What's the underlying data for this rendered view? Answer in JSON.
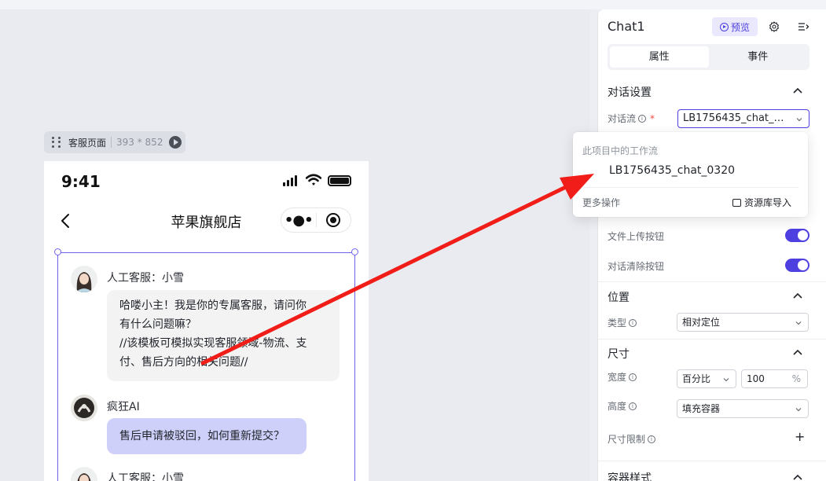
{
  "canvas": {
    "page_tag": {
      "name": "客服页面",
      "dims": "393 * 852"
    },
    "phone": {
      "time": "9:41",
      "nav_title": "苹果旗舰店",
      "capsule_dots": "•●•",
      "messages": [
        {
          "sender": "人工客服：小雪",
          "lines": [
            "哈喽小主！我是你的专属客服，请问你",
            "有什么问题嘛？",
            "//该模板可模拟实现客服领域-物流、支",
            "付、售后方向的相关问题//"
          ]
        },
        {
          "sender": "疯狂AI",
          "lines": [
            "售后申请被驳回，如何重新提交？"
          ]
        },
        {
          "sender": "人工客服：小雪",
          "lines": []
        }
      ]
    }
  },
  "panel": {
    "title": "Chat1",
    "preview_label": "预览",
    "tabs": [
      {
        "label": "属性",
        "active": true
      },
      {
        "label": "事件",
        "active": false
      }
    ],
    "dialog_settings": {
      "title": "对话设置",
      "flow_label": "对话流",
      "flow_value": "LB1756435_chat_…",
      "upload_label": "文件上传按钮",
      "clear_label": "对话清除按钮"
    },
    "position": {
      "title": "位置",
      "type_label": "类型",
      "type_value": "相对定位"
    },
    "size": {
      "title": "尺寸",
      "width_label": "宽度",
      "width_mode": "百分比",
      "width_value": "100",
      "width_unit": "%",
      "height_label": "高度",
      "height_value": "填充容器",
      "limit_label": "尺寸限制",
      "add": "+"
    },
    "container_style": {
      "title": "容器样式"
    }
  },
  "popover": {
    "group_label": "此项目中的工作流",
    "item": "LB1756435_chat_0320",
    "more": "更多操作",
    "import": "资源库导入"
  },
  "colors": {
    "accent": "#4e3fe0",
    "annotation_arrow": "#f01d18",
    "selection": "#6f63ee"
  }
}
